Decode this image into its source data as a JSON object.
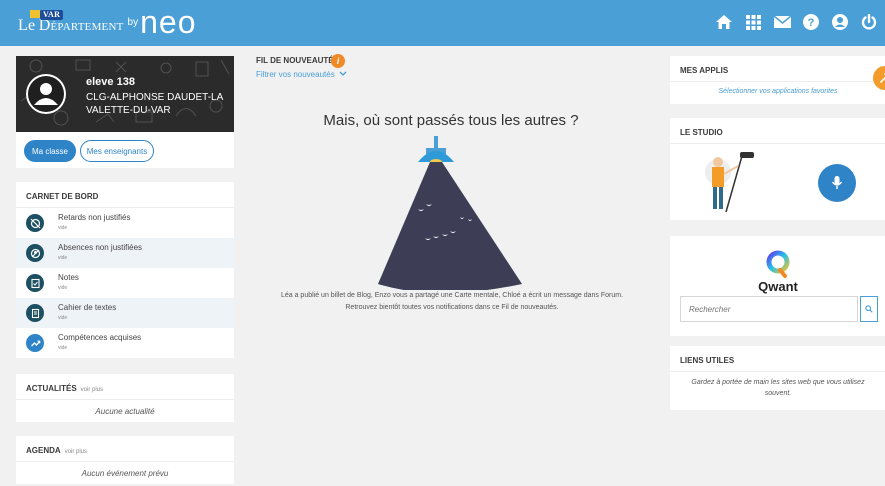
{
  "header": {
    "brand_le": "Le",
    "brand_departement": "Département",
    "brand_var": "VAR",
    "brand_by": "by",
    "brand_neo": "neo",
    "icons": [
      "home-icon",
      "apps-grid-icon",
      "mail-icon",
      "help-icon",
      "user-icon",
      "power-icon"
    ]
  },
  "profile": {
    "name": "eleve 138",
    "school": "CLG-ALPHONSE DAUDET-LA VALETTE-DU-VAR",
    "btn_classe": "Ma classe",
    "btn_enseignants": "Mes enseignants"
  },
  "carnet": {
    "title": "CARNET DE BORD",
    "items": [
      {
        "label": "Retards non justifiés",
        "sub": "vide"
      },
      {
        "label": "Absences non justifiées",
        "sub": "vide"
      },
      {
        "label": "Notes",
        "sub": "vide"
      },
      {
        "label": "Cahier de textes",
        "sub": "vide"
      },
      {
        "label": "Compétences acquises",
        "sub": "vide"
      }
    ]
  },
  "actualites": {
    "title": "ACTUALITÉS",
    "more": "voir plus",
    "empty": "Aucune actualité"
  },
  "agenda": {
    "title": "AGENDA",
    "more": "voir plus",
    "empty": "Aucun événement prévu"
  },
  "fil": {
    "title": "FIL DE NOUVEAUTÉS",
    "info": "i",
    "filter": "Filtrer vos nouveautés",
    "heading": "Mais, où sont passés tous les autres ?",
    "message": "Léa a publié un billet de Blog, Enzo vous a partagé une Carte mentale, Chloé a écrit un message dans Forum. Retrouvez bientôt toutes vos notifications dans ce Fil de nouveautés."
  },
  "mesapplis": {
    "title": "MES APPLIS",
    "link": "Sélectionner vos applications favorites"
  },
  "studio": {
    "title": "LE STUDIO"
  },
  "qwant": {
    "name": "Qwant",
    "placeholder": "Rechercher"
  },
  "liens": {
    "title": "LIENS UTILES",
    "text": "Gardez à portée de main les sites web que vous utilisez souvent."
  },
  "colors": {
    "topbar": "#4a9fd6",
    "primary": "#2f84c8",
    "accent": "#f08a24",
    "dark_teal": "#1d4f63"
  }
}
